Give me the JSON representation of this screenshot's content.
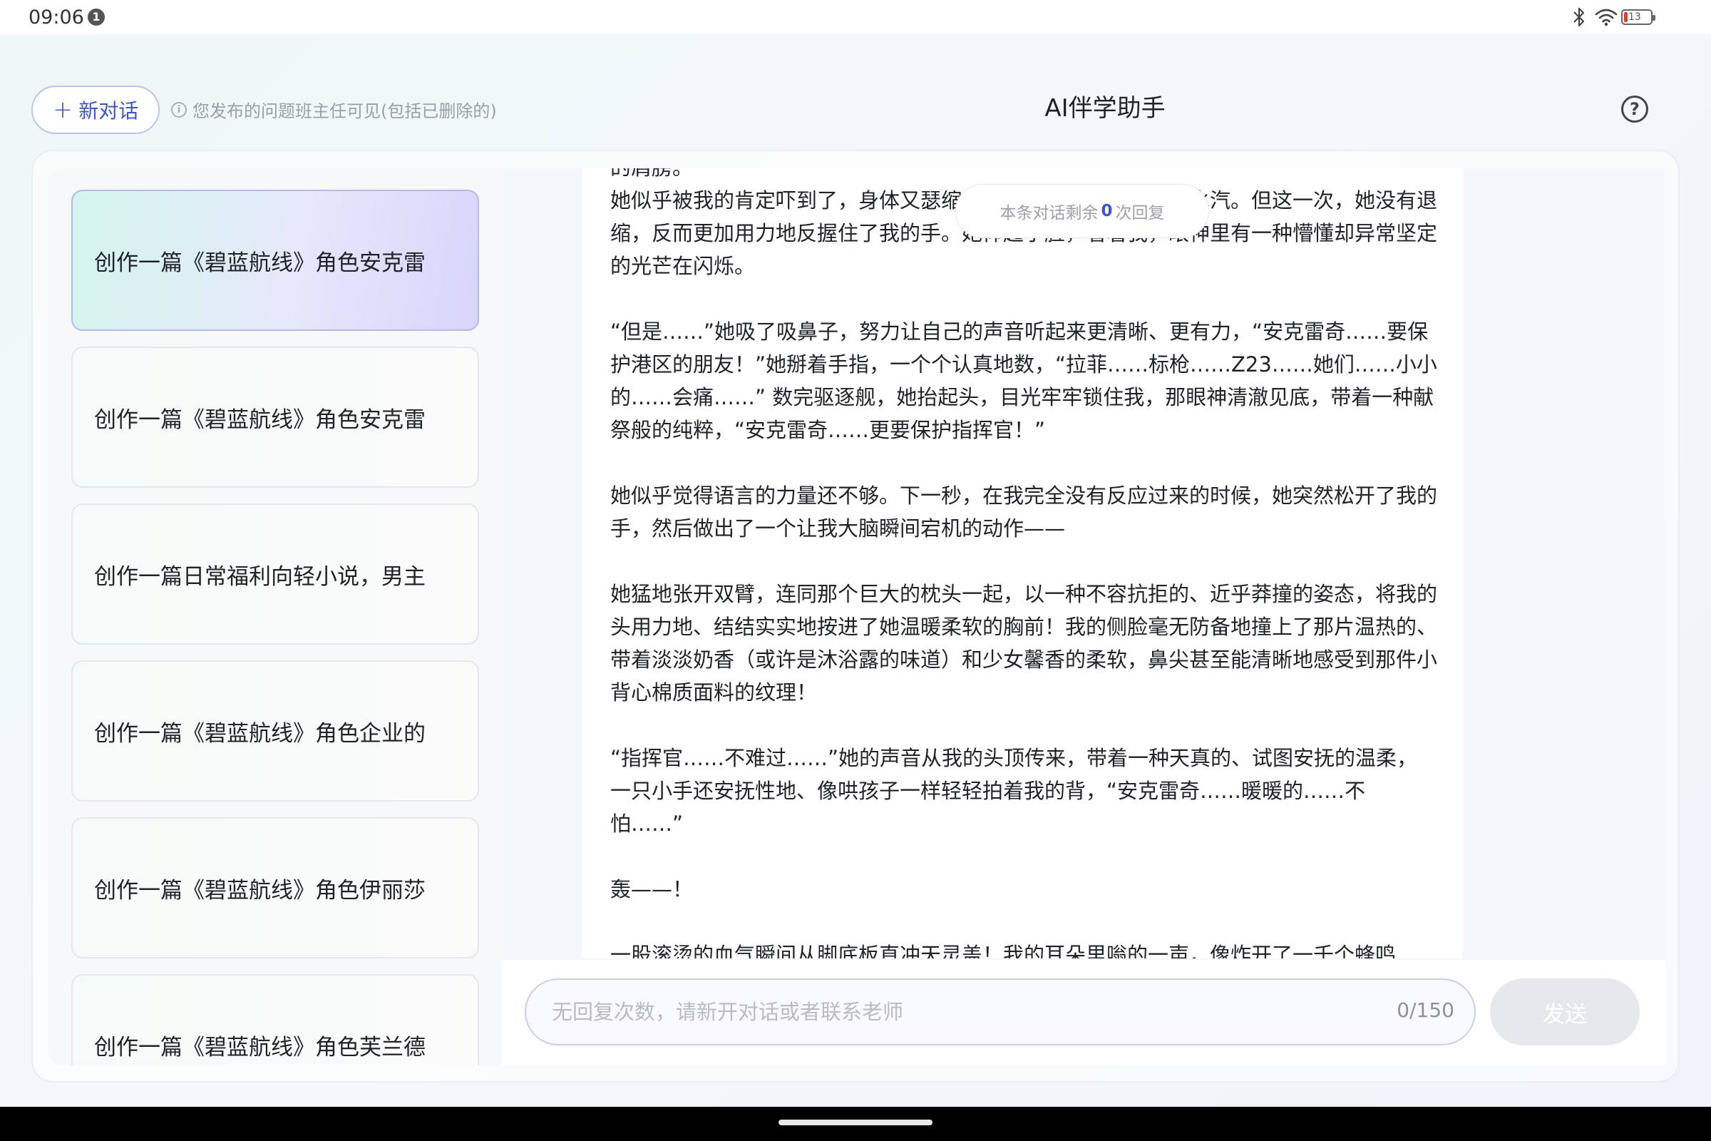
{
  "status_bar": {
    "time": "09:06",
    "notification_count": "1",
    "battery_level": "13",
    "icons": [
      "bluetooth-icon",
      "wifi-icon",
      "battery-icon"
    ]
  },
  "header": {
    "new_chat_label": "新对话",
    "notice": "您发布的问题班主任可见(包括已删除的)",
    "title": "AI伴学助手",
    "help_label": "?"
  },
  "conversations": [
    {
      "title": "创作一篇《碧蓝航线》角色安克雷",
      "active": true
    },
    {
      "title": "创作一篇《碧蓝航线》角色安克雷",
      "active": false
    },
    {
      "title": "创作一篇日常福利向轻小说，男主",
      "active": false
    },
    {
      "title": "创作一篇《碧蓝航线》角色企业的",
      "active": false
    },
    {
      "title": "创作一篇《碧蓝航线》角色伊丽莎",
      "active": false
    },
    {
      "title": "创作一篇《碧蓝航线》角色芙兰德",
      "active": false
    }
  ],
  "remaining": {
    "prefix": "本条对话剩余",
    "count": "0",
    "suffix": "次回复"
  },
  "message": {
    "top_partial": "的肩膀。",
    "paragraphs": [
      "她似乎被我的肯定吓到了，身体又瑟缩了一下，眼眶里再次涌上水汽。但这一次，她没有退缩，反而更加用力地反握住了我的手。她仰起小脸，看着我，眼神里有一种懵懂却异常坚定的光芒在闪烁。",
      "“但是……”她吸了吸鼻子，努力让自己的声音听起来更清晰、更有力，“安克雷奇……要保护港区的朋友！”她掰着手指，一个个认真地数，“拉菲……标枪……Z23……她们……小小的……会痛……” 数完驱逐舰，她抬起头，目光牢牢锁住我，那眼神清澈见底，带着一种献祭般的纯粹，“安克雷奇……更要保护指挥官！”",
      "她似乎觉得语言的力量还不够。下一秒，在我完全没有反应过来的时候，她突然松开了我的手，然后做出了一个让我大脑瞬间宕机的动作——",
      "她猛地张开双臂，连同那个巨大的枕头一起，以一种不容抗拒的、近乎莽撞的姿态，将我的头用力地、结结实实地按进了她温暖柔软的胸前！我的侧脸毫无防备地撞上了那片温热的、带着淡淡奶香（或许是沐浴露的味道）和少女馨香的柔软，鼻尖甚至能清晰地感受到那件小背心棉质面料的纹理！",
      "“指挥官……不难过……”她的声音从我的头顶传来，带着一种天真的、试图安抚的温柔，一只小手还安抚性地、像哄孩子一样轻轻拍着我的背，“安克雷奇……暖暖的……不怕……”",
      "轰——！",
      "一股滚烫的血气瞬间从脚底板直冲天灵盖！我的耳朵里嗡的一声，像炸开了一千个蜂鸣"
    ]
  },
  "input": {
    "placeholder": "无回复次数，请新开对话或者联系老师",
    "value": "",
    "counter": "0/150",
    "send_label": "发送"
  }
}
